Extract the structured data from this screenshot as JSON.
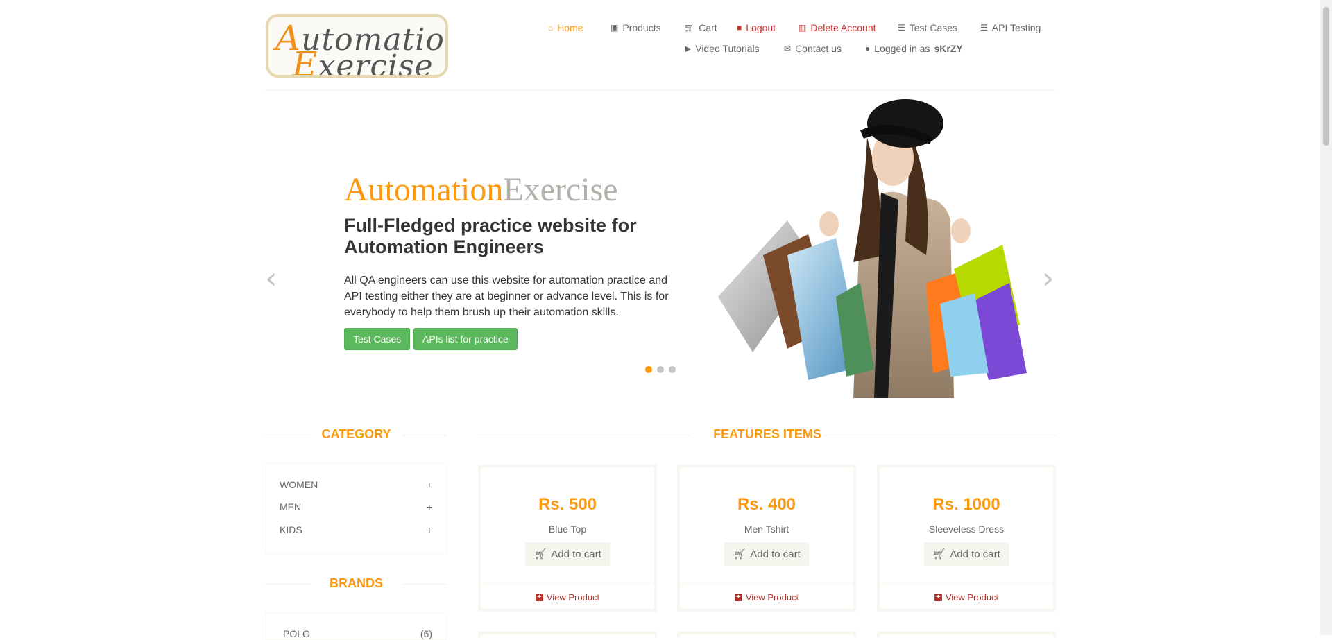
{
  "logo": {
    "line1_cap": "A",
    "line1_rest": "utomation",
    "line2_cap": "E",
    "line2_rest": "xercise"
  },
  "nav": {
    "home": "Home",
    "products": "Products",
    "cart": "Cart",
    "logout": "Logout",
    "delete_account": "Delete Account",
    "test_cases": "Test Cases",
    "api_testing": "API Testing",
    "video_tutorials": "Video Tutorials",
    "contact_us": "Contact us",
    "logged_in_prefix": "Logged in as",
    "username": "sKrZY"
  },
  "slider": {
    "brand_part1": "Automation",
    "brand_part2": "Exercise",
    "headline": "Full-Fledged practice website for Automation Engineers",
    "description": "All QA engineers can use this website for automation practice and API testing either they are at beginner or advance level. This is for everybody to help them brush up their automation skills.",
    "btn_test_cases": "Test Cases",
    "btn_apis": "APIs list for practice",
    "prev_arrow": "‹",
    "next_arrow": "›",
    "active_slide": 1,
    "slide_count": 3
  },
  "category": {
    "title": "CATEGORY",
    "items": [
      {
        "label": "WOMEN",
        "icon": "+"
      },
      {
        "label": "MEN",
        "icon": "+"
      },
      {
        "label": "KIDS",
        "icon": "+"
      }
    ]
  },
  "brands": {
    "title": "BRANDS",
    "items": [
      {
        "label": "POLO",
        "count": "(6)"
      }
    ]
  },
  "features": {
    "title": "FEATURES ITEMS",
    "products": [
      {
        "price": "Rs. 500",
        "name": "Blue Top",
        "add_label": "Add to cart",
        "view_label": "View Product"
      },
      {
        "price": "Rs. 400",
        "name": "Men Tshirt",
        "add_label": "Add to cart",
        "view_label": "View Product"
      },
      {
        "price": "Rs. 1000",
        "name": "Sleeveless Dress",
        "add_label": "Add to cart",
        "view_label": "View Product"
      }
    ]
  },
  "colors": {
    "accent": "#fe980f",
    "green": "#5cb85c",
    "danger": "#b0342d",
    "text": "#696763"
  }
}
